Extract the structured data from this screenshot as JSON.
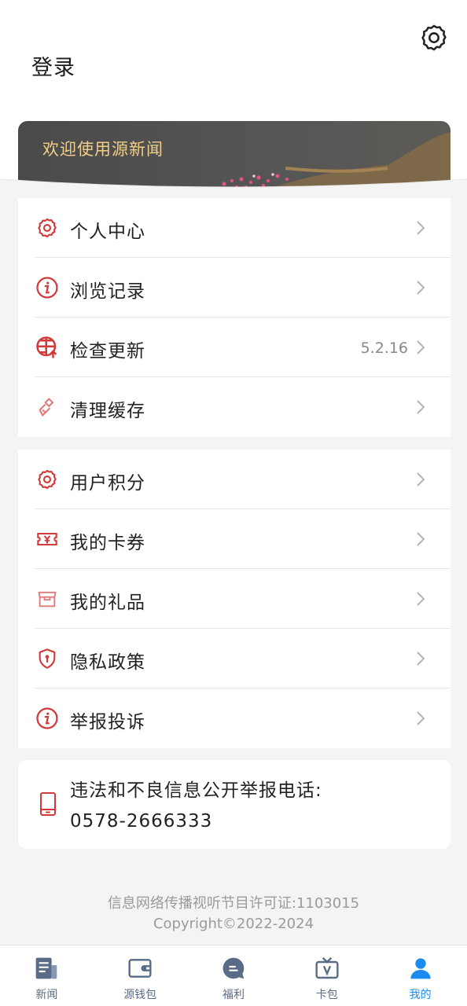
{
  "header": {
    "login_label": "登录",
    "banner_text": "欢迎使用源新闻"
  },
  "menu_group_1": [
    {
      "label": "个人中心",
      "icon": "gear-icon",
      "value": ""
    },
    {
      "label": "浏览记录",
      "icon": "info-icon",
      "value": ""
    },
    {
      "label": "检查更新",
      "icon": "globe-upload-icon",
      "value": "5.2.16"
    },
    {
      "label": "清理缓存",
      "icon": "broom-icon",
      "value": ""
    }
  ],
  "menu_group_2": [
    {
      "label": "用户积分",
      "icon": "gear-icon",
      "value": ""
    },
    {
      "label": "我的卡券",
      "icon": "coupon-icon",
      "value": ""
    },
    {
      "label": "我的礼品",
      "icon": "gift-box-icon",
      "value": ""
    },
    {
      "label": "隐私政策",
      "icon": "shield-icon",
      "value": ""
    },
    {
      "label": "举报投诉",
      "icon": "info-icon",
      "value": ""
    }
  ],
  "report": {
    "line1": "违法和不良信息公开举报电话:",
    "line2": "0578-2666333",
    "icon": "phone-icon"
  },
  "footer": {
    "license": "信息网络传播视听节目许可证:1103015",
    "copyright": "Copyright©2022-2024"
  },
  "tabs": [
    {
      "label": "新闻",
      "icon": "news-icon",
      "active": false
    },
    {
      "label": "源钱包",
      "icon": "wallet-icon",
      "active": false
    },
    {
      "label": "福利",
      "icon": "chat-bubble-icon",
      "active": false
    },
    {
      "label": "卡包",
      "icon": "tv-card-icon",
      "active": false
    },
    {
      "label": "我的",
      "icon": "user-icon",
      "active": true
    }
  ],
  "colors": {
    "accent_red": "#d23a3a",
    "banner_gold": "#f1cf86",
    "tab_active": "#1a8cf0",
    "tab_inactive": "#5a6b86"
  }
}
